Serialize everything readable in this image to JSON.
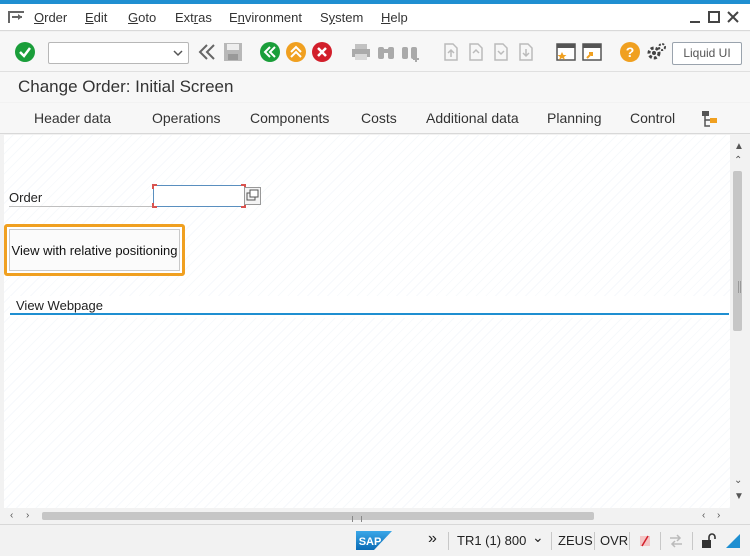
{
  "menubar": {
    "items": [
      "Order",
      "Edit",
      "Goto",
      "Extras",
      "Environment",
      "System",
      "Help"
    ],
    "underlines": [
      "O",
      "E",
      "G",
      "r",
      "n",
      "y",
      "H"
    ]
  },
  "toolbar": {
    "command_field_value": "",
    "liquid_ui_label": "Liquid UI"
  },
  "title": "Change Order: Initial Screen",
  "app_toolbar": {
    "buttons": [
      "Header data",
      "Operations",
      "Components",
      "Costs",
      "Additional data",
      "Planning",
      "Control"
    ]
  },
  "content": {
    "order_label": "Order",
    "order_value": "",
    "relative_button_label": "View with relative positioning",
    "webpage_section_label": "View Webpage"
  },
  "statusbar": {
    "system": "TR1 (1) 800",
    "server": "ZEUS",
    "mode": "OVR",
    "nav_glyph": "»",
    "dropdown_glyph": "⌄"
  },
  "colors": {
    "accent_blue": "#1f8fd1",
    "highlight_orange": "#f0a020",
    "enter_green": "#1a9e3a",
    "exit_red": "#d21f2b",
    "help_orange": "#f0a020"
  }
}
